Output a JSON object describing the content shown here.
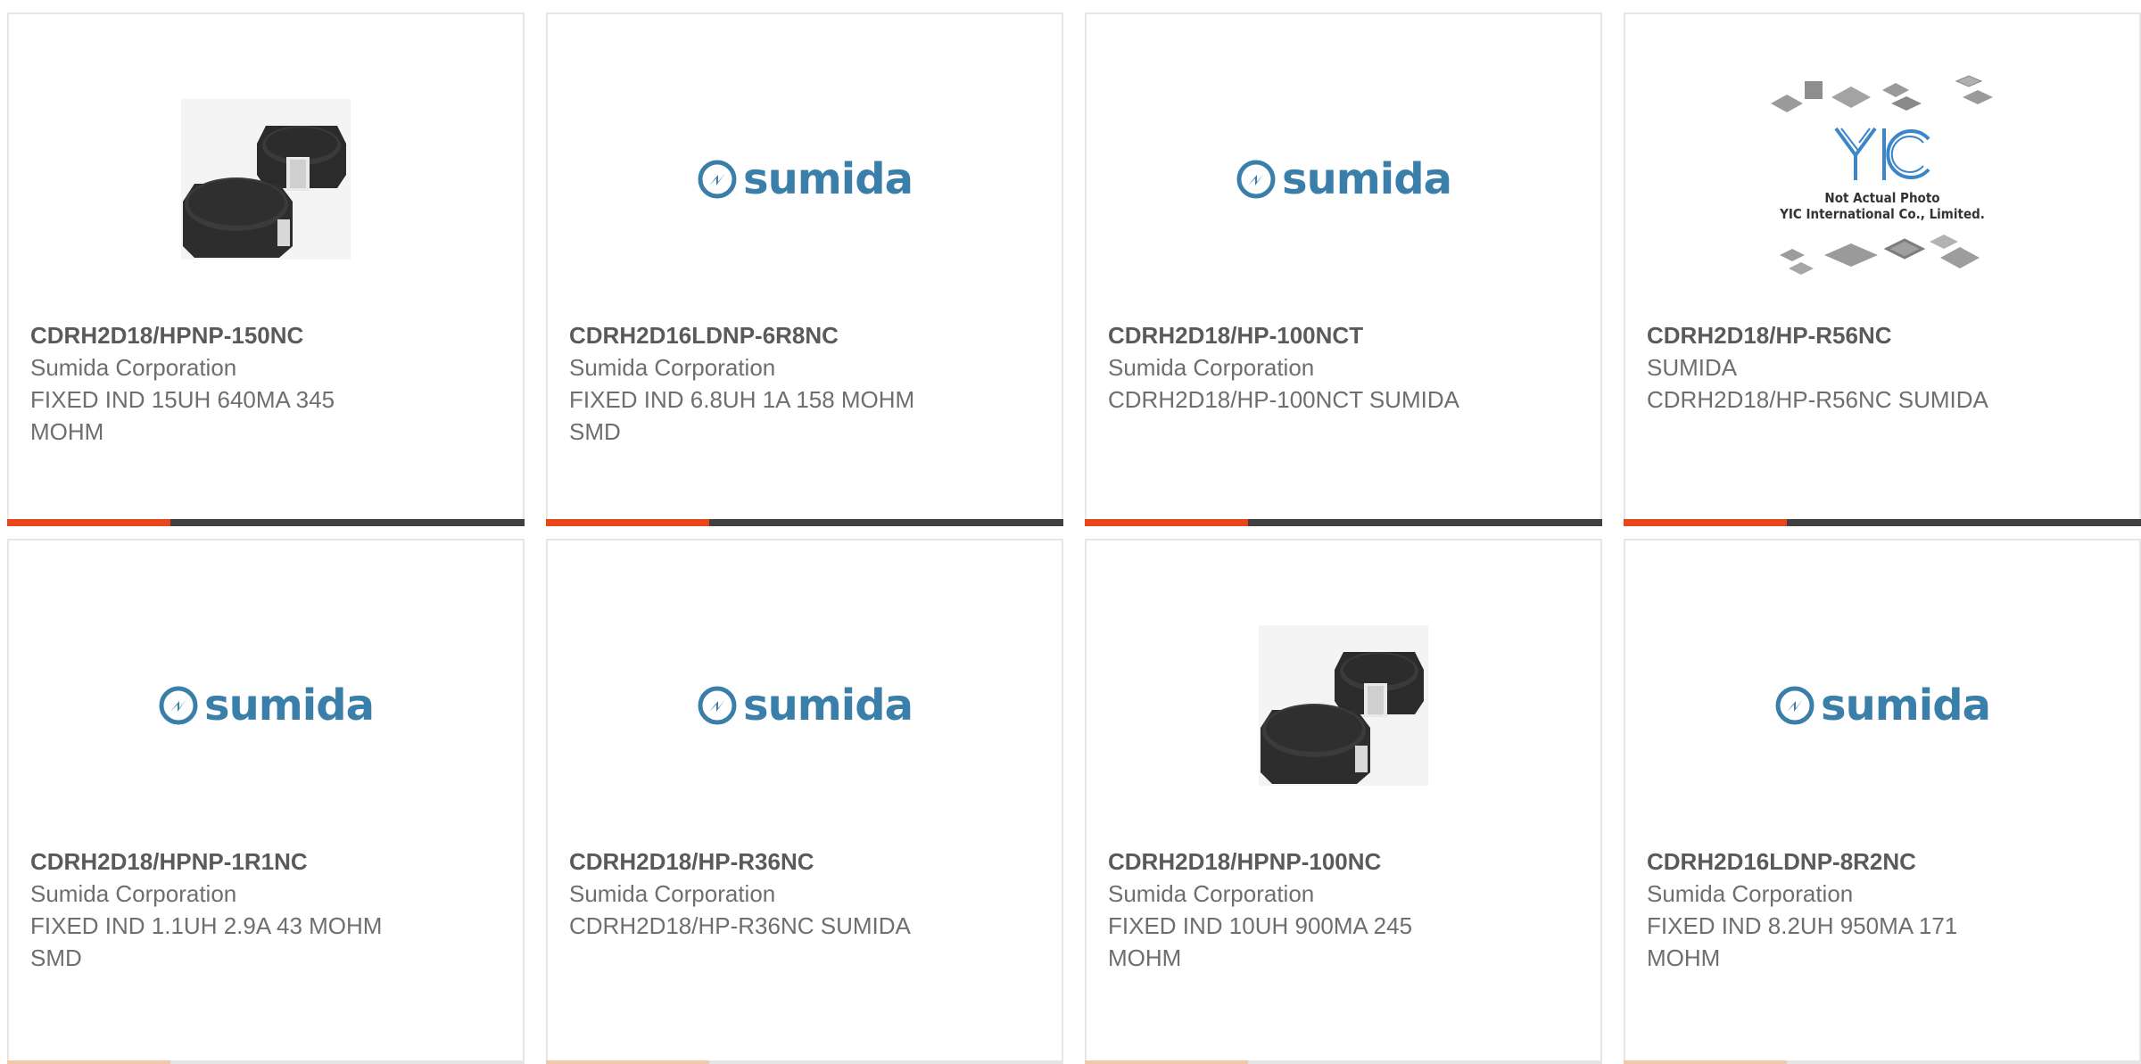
{
  "logo_text": "sumida",
  "yic_text": {
    "brand": "YIC",
    "line1": "Not Actual Photo",
    "line2": "YIC International Co., Limited."
  },
  "colors": {
    "accent": "#e8461b",
    "bar_dark": "#3f3f3f",
    "sumida_blue": "#3a7fa9"
  },
  "products": [
    {
      "part_number": "CDRH2D18/HPNP-150NC",
      "manufacturer": "Sumida Corporation",
      "description": "FIXED IND 15UH 640MA 345 MOHM",
      "image": "inductor-photo"
    },
    {
      "part_number": "CDRH2D16LDNP-6R8NC",
      "manufacturer": "Sumida Corporation",
      "description": "FIXED IND 6.8UH 1A 158 MOHM SMD",
      "image": "sumida-logo"
    },
    {
      "part_number": "CDRH2D18/HP-100NCT",
      "manufacturer": "Sumida Corporation",
      "description": "CDRH2D18/HP-100NCT SUMIDA",
      "image": "sumida-logo"
    },
    {
      "part_number": "CDRH2D18/HP-R56NC",
      "manufacturer": "SUMIDA",
      "description": "CDRH2D18/HP-R56NC SUMIDA",
      "image": "yic-placeholder"
    },
    {
      "part_number": "CDRH2D18/HPNP-1R1NC",
      "manufacturer": "Sumida Corporation",
      "description": "FIXED IND 1.1UH 2.9A 43 MOHM SMD",
      "image": "sumida-logo"
    },
    {
      "part_number": "CDRH2D18/HP-R36NC",
      "manufacturer": "Sumida Corporation",
      "description": "CDRH2D18/HP-R36NC SUMIDA",
      "image": "sumida-logo"
    },
    {
      "part_number": "CDRH2D18/HPNP-100NC",
      "manufacturer": "Sumida Corporation",
      "description": "FIXED IND 10UH 900MA 245 MOHM",
      "image": "inductor-photo"
    },
    {
      "part_number": "CDRH2D16LDNP-8R2NC",
      "manufacturer": "Sumida Corporation",
      "description": "FIXED IND 8.2UH 950MA 171 MOHM",
      "image": "sumida-logo"
    }
  ]
}
